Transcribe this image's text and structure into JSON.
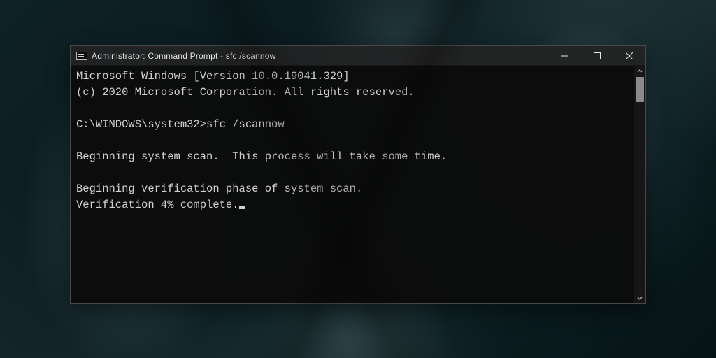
{
  "window": {
    "title": "Administrator: Command Prompt - sfc  /scannow"
  },
  "terminal": {
    "banner_line1": "Microsoft Windows [Version 10.0.19041.329]",
    "banner_line2": "(c) 2020 Microsoft Corporation. All rights reserved.",
    "prompt": "C:\\WINDOWS\\system32>",
    "command": "sfc /scannow",
    "msg_begin_scan": "Beginning system scan.  This process will take some time.",
    "msg_begin_verify": "Beginning verification phase of system scan.",
    "msg_verify_progress": "Verification 4% complete."
  }
}
